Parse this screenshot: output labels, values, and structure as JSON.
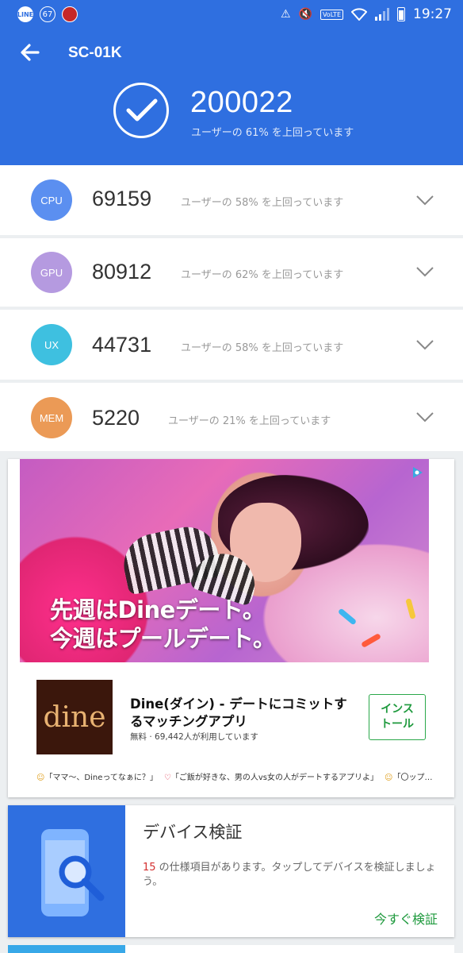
{
  "status_bar": {
    "line_label": "LINE",
    "badge_count": "67",
    "volte": "VoLTE",
    "time": "19:27"
  },
  "header": {
    "title": "SC-01K",
    "total_score": "200022",
    "total_subtitle": "ユーザーの 61% を上回っています"
  },
  "scores": [
    {
      "label": "CPU",
      "value": "69159",
      "subtitle": "ユーザーの 58% を上回っています",
      "color": "#5b8ff0"
    },
    {
      "label": "GPU",
      "value": "80912",
      "subtitle": "ユーザーの 62% を上回っています",
      "color": "#b59ae0"
    },
    {
      "label": "UX",
      "value": "44731",
      "subtitle": "ユーザーの 58% を上回っています",
      "color": "#3ec0e0"
    },
    {
      "label": "MEM",
      "value": "5220",
      "subtitle": "ユーザーの 21% を上回っています",
      "color": "#eb9a56"
    }
  ],
  "ad": {
    "headline_line1": "先週はDineデート。",
    "headline_line2": "今週はプールデート。",
    "app_icon_text": "dine",
    "app_name": "Dine(ダイン) - デートにコミットするマッチングアプリ",
    "app_meta": "無料 · 69,442人が利用しています",
    "install_label_line1": "インス",
    "install_label_line2": "トール",
    "reviews": [
      "「ママ〜、Dineってなぁに？」",
      "「ご飯が好きな、男の人vs女の人がデートするアプリよ」",
      "「〇ップ…"
    ]
  },
  "verify": {
    "title": "デバイス検証",
    "count": "15",
    "description": " の仕様項目があります。タップしてデバイスを検証しましょう。",
    "action": "今すぐ検証"
  },
  "colors": {
    "primary": "#2f6fe0",
    "accent_green": "#1f9a3e"
  }
}
